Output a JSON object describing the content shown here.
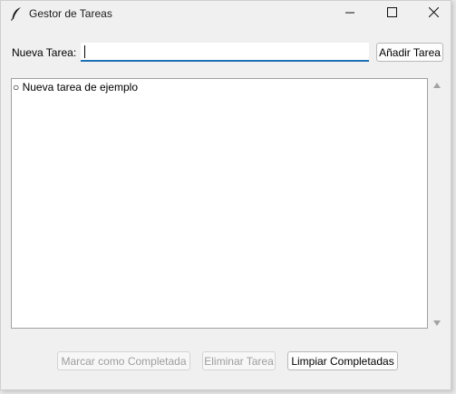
{
  "window": {
    "title": "Gestor de Tareas",
    "icons": {
      "app": "feather-icon",
      "minimize": "minimize-icon",
      "maximize": "maximize-icon",
      "close": "close-icon"
    }
  },
  "form": {
    "label": "Nueva Tarea:",
    "input_value": "",
    "add_button": "Añadir Tarea"
  },
  "tasks": [
    {
      "text": "○ Nueva tarea de ejemplo"
    }
  ],
  "actions": {
    "mark_complete": "Marcar como Completada",
    "delete": "Eliminar Tarea",
    "clear_completed": "Limpiar Completadas"
  },
  "colors": {
    "input_underline": "#1f6fb5",
    "disabled_text": "#9d9d9d",
    "window_bg": "#f0f0f0"
  }
}
